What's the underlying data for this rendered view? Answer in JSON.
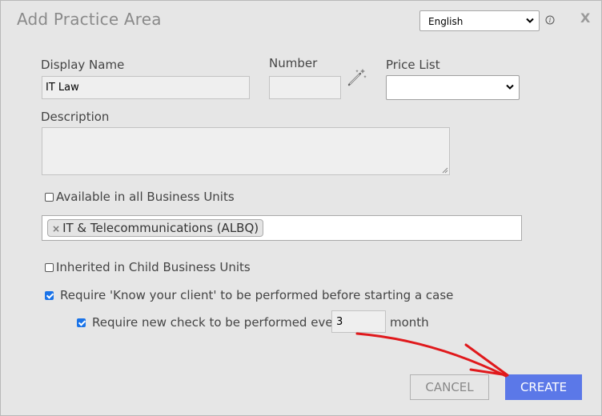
{
  "dialog": {
    "title": "Add Practice Area",
    "language": "English",
    "close_label": "X"
  },
  "form": {
    "display_name": {
      "label": "Display Name",
      "value": "IT Law"
    },
    "number": {
      "label": "Number",
      "value": ""
    },
    "price_list": {
      "label": "Price List",
      "value": ""
    },
    "description": {
      "label": "Description",
      "value": ""
    },
    "available_all_units": {
      "label": "Available in all Business Units",
      "checked": false
    },
    "business_units": [
      {
        "label": "IT & Telecommunications (ALBQ)"
      }
    ],
    "inherited_child_units": {
      "label": "Inherited in Child Business Units",
      "checked": false
    },
    "require_kyc": {
      "label": "Require 'Know your client' to be performed before starting a case",
      "checked": true
    },
    "require_new_check": {
      "label": "Require new check to be performed every",
      "checked": true,
      "value": "3",
      "unit": "month"
    }
  },
  "buttons": {
    "cancel": "CANCEL",
    "create": "CREATE"
  },
  "colors": {
    "primary": "#5b78e8",
    "annotation_arrow": "#e0191c",
    "checkbox": "#1a73e8"
  }
}
